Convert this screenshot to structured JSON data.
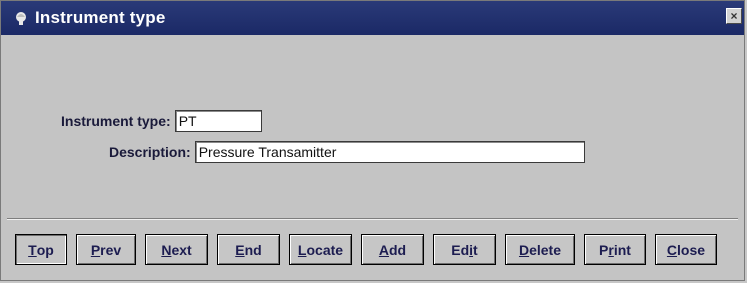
{
  "window": {
    "title": "Instrument type",
    "close_glyph": "×"
  },
  "form": {
    "instrument_type_label": "Instrument type:",
    "instrument_type_value": "PT",
    "description_label": "Description:",
    "description_value": "Pressure Transamitter"
  },
  "toolbar": {
    "buttons": [
      {
        "key": "T",
        "rest": "op"
      },
      {
        "key": "P",
        "rest": "rev"
      },
      {
        "key": "N",
        "rest": "ext"
      },
      {
        "key": "E",
        "rest": "nd"
      },
      {
        "key": "L",
        "rest": "ocate"
      },
      {
        "key": "A",
        "rest": "dd"
      },
      {
        "pre": "Ed",
        "key": "i",
        "rest": "t"
      },
      {
        "key": "D",
        "rest": "elete"
      },
      {
        "pre": "P",
        "key": "r",
        "rest": "int"
      },
      {
        "key": "C",
        "rest": "lose"
      }
    ]
  },
  "colors": {
    "titlebar": "#1b2966",
    "window_bg": "#c4c4c4",
    "button_text": "#1c1c50"
  }
}
